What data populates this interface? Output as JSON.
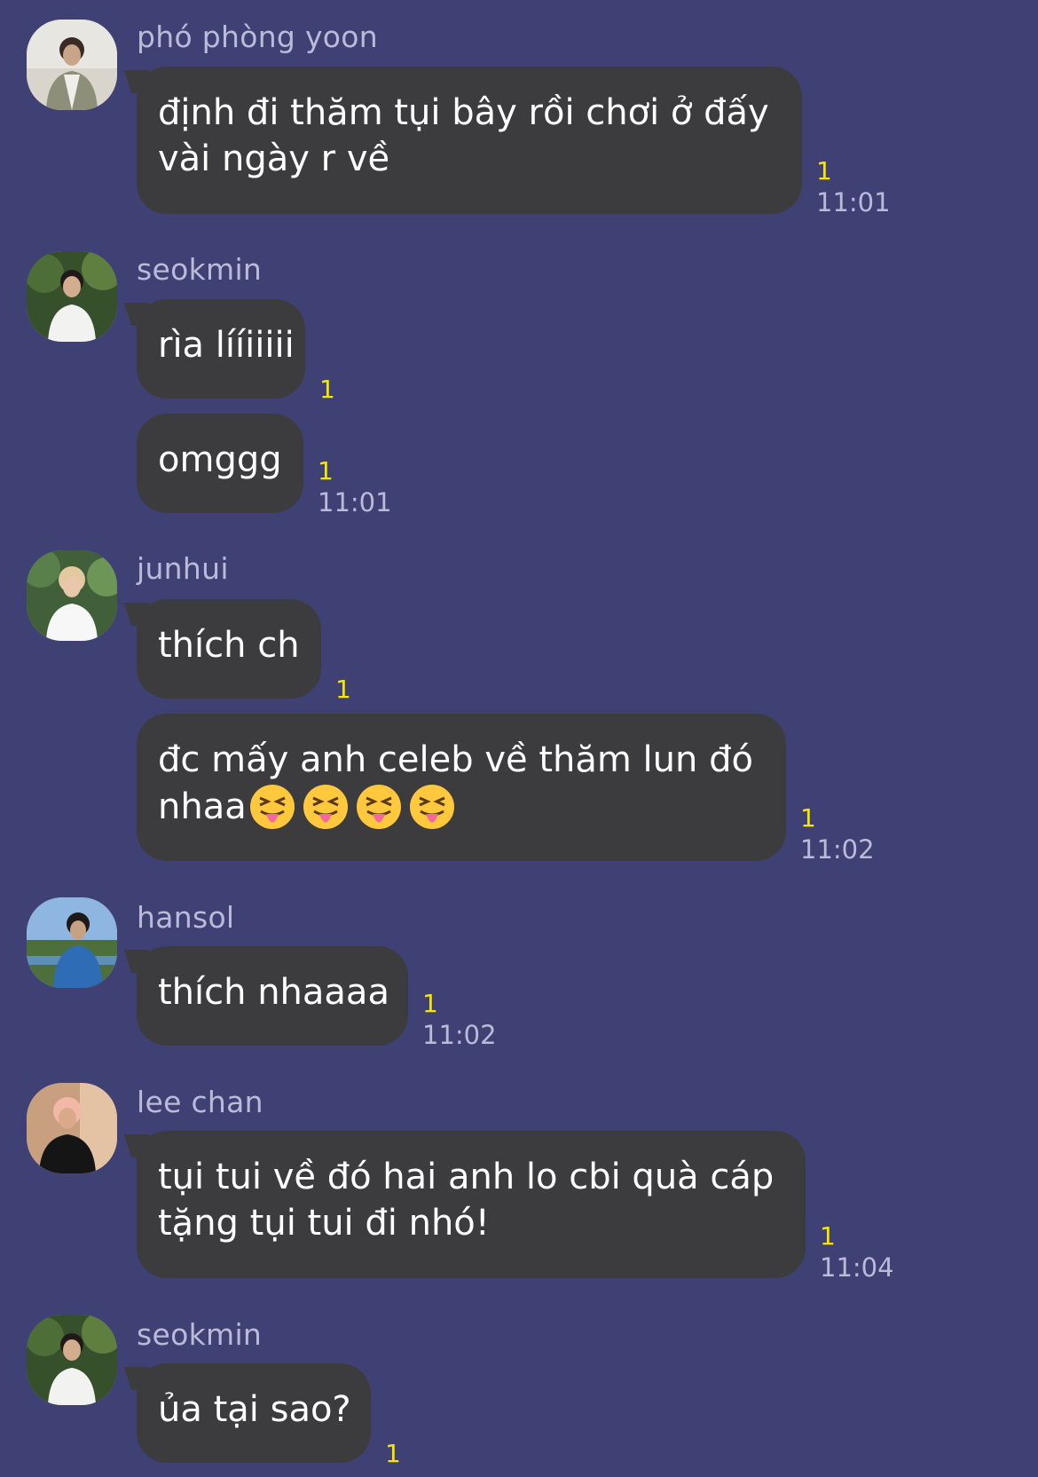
{
  "messages": [
    {
      "sender": "phó phòng yoon",
      "bubbles": [
        {
          "lines": [
            "định đi thăm tụi bây rồi chơi ở đấy",
            "vài ngày r về"
          ],
          "read": "1",
          "time": "11:01"
        }
      ]
    },
    {
      "sender": "seokmin",
      "bubbles": [
        {
          "lines": [
            "rìa lííiiiii"
          ],
          "read": "1",
          "time": ""
        },
        {
          "lines": [
            "omggg"
          ],
          "read": "1",
          "time": "11:01"
        }
      ]
    },
    {
      "sender": "junhui",
      "bubbles": [
        {
          "lines": [
            "thích ch"
          ],
          "read": "1",
          "time": ""
        },
        {
          "lines": [
            "đc mấy anh celeb về thăm lun đó",
            "nhaa"
          ],
          "read": "1",
          "time": "11:02",
          "emoji": "squinting-face-with-tongue-x4"
        }
      ]
    },
    {
      "sender": "hansol",
      "bubbles": [
        {
          "lines": [
            "thích nhaaaa"
          ],
          "read": "1",
          "time": "11:02"
        }
      ]
    },
    {
      "sender": "lee chan",
      "bubbles": [
        {
          "lines": [
            "tụi tui về đó hai anh lo cbi quà cáp",
            "tặng tụi tui đi nhó!"
          ],
          "read": "1",
          "time": "11:04"
        }
      ]
    },
    {
      "sender": "seokmin",
      "bubbles": [
        {
          "lines": [
            "ủa tại sao?"
          ],
          "read": "1",
          "time": ""
        }
      ]
    }
  ],
  "colors": {
    "background": "#3f4174",
    "bubble": "#3c3c3e",
    "unread_count": "#f7e600",
    "meta_text": "#b9bbd8"
  }
}
